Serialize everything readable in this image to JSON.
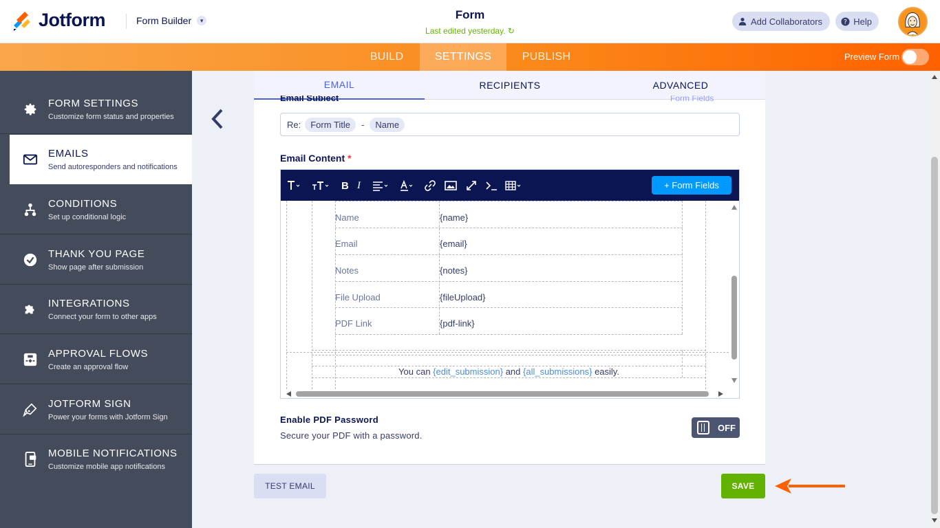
{
  "app": {
    "logo_text": "Jotform",
    "builder_label": "Form Builder",
    "form_title": "Form",
    "last_edited": "Last edited yesterday.",
    "add_collaborators": "Add Collaborators",
    "help": "Help"
  },
  "nav": {
    "tabs": [
      {
        "label": "BUILD"
      },
      {
        "label": "SETTINGS"
      },
      {
        "label": "PUBLISH"
      }
    ],
    "preview_label": "Preview Form"
  },
  "sidebar": {
    "items": [
      {
        "title": "FORM SETTINGS",
        "subtitle": "Customize form status and properties",
        "icon": "gear-icon"
      },
      {
        "title": "EMAILS",
        "subtitle": "Send autoresponders and notifications",
        "icon": "envelope-icon"
      },
      {
        "title": "CONDITIONS",
        "subtitle": "Set up conditional logic",
        "icon": "sitemap-icon"
      },
      {
        "title": "THANK YOU PAGE",
        "subtitle": "Show page after submission",
        "icon": "check-circle-icon"
      },
      {
        "title": "INTEGRATIONS",
        "subtitle": "Connect your form to other apps",
        "icon": "puzzle-icon"
      },
      {
        "title": "APPROVAL FLOWS",
        "subtitle": "Create an approval flow",
        "icon": "flow-icon"
      },
      {
        "title": "JOTFORM SIGN",
        "subtitle": "Power your forms with Jotform Sign",
        "icon": "pen-icon"
      },
      {
        "title": "MOBILE NOTIFICATIONS",
        "subtitle": "Customize mobile app notifications",
        "icon": "mobile-icon"
      }
    ]
  },
  "email_tabs": [
    {
      "label": "EMAIL"
    },
    {
      "label": "RECIPIENTS"
    },
    {
      "label": "ADVANCED"
    }
  ],
  "subject": {
    "label": "Email Subject",
    "form_fields_link": "Form Fields",
    "prefix": "Re:",
    "chip_1": "Form Title",
    "separator": "-",
    "chip_2": "Name"
  },
  "content": {
    "label": "Email Content",
    "required_mark": "*",
    "form_fields_button": "+ Form Fields",
    "rows": [
      {
        "key": "Name",
        "value": "{name}"
      },
      {
        "key": "Email",
        "value": "{email}"
      },
      {
        "key": "Notes",
        "value": "{notes}"
      },
      {
        "key": "File Upload",
        "value": "{fileUpload}"
      },
      {
        "key": "PDF Link",
        "value": "{pdf-link}"
      }
    ],
    "footer": {
      "part1": "You can ",
      "tag1": "{edit_submission}",
      "part2": " and ",
      "tag2": "{all_submissions}",
      "part3": " easily."
    }
  },
  "pdf_password": {
    "title": "Enable PDF Password",
    "subtitle": "Secure your PDF with a password.",
    "toggle_label": "OFF"
  },
  "buttons": {
    "test_email": "TEST EMAIL",
    "save": "SAVE"
  },
  "colors": {
    "brand_navy": "#0a1551",
    "save_green": "#64b200",
    "accent_blue": "#0099ff",
    "nav_orange": "#ff6100"
  }
}
